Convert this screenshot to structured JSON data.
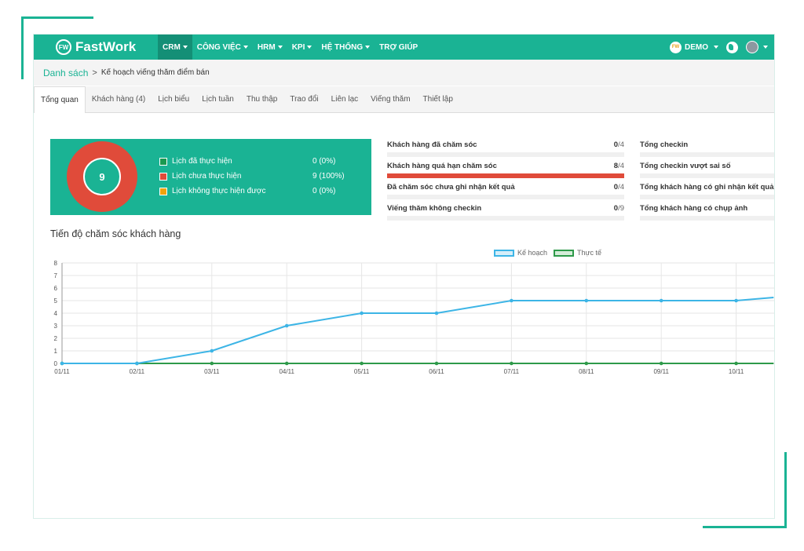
{
  "app": {
    "logo_badge": "FW",
    "logo_text": "FastWork",
    "brand_color": "#1ab394"
  },
  "nav": {
    "items": [
      {
        "label": "CRM",
        "active": true
      },
      {
        "label": "CÔNG VIỆC",
        "active": false
      },
      {
        "label": "HRM",
        "active": false
      },
      {
        "label": "KPI",
        "active": false
      },
      {
        "label": "HỆ THỐNG",
        "active": false
      },
      {
        "label": "TRỢ GIÚP",
        "active": false
      }
    ],
    "demo_badge": "FW",
    "demo_label": "DEMO"
  },
  "breadcrumb": {
    "link": "Danh sách",
    "separator": ">",
    "current": "Kế hoạch viếng thăm điểm bán"
  },
  "tabs": [
    {
      "label": "Tổng quan",
      "active": true
    },
    {
      "label": "Khách hàng (4)",
      "active": false
    },
    {
      "label": "Lịch biểu",
      "active": false
    },
    {
      "label": "Lịch tuần",
      "active": false
    },
    {
      "label": "Thu thập",
      "active": false
    },
    {
      "label": "Trao đổi",
      "active": false
    },
    {
      "label": "Liên lạc",
      "active": false
    },
    {
      "label": "Viếng thăm",
      "active": false
    },
    {
      "label": "Thiết lập",
      "active": false
    }
  ],
  "summary": {
    "total": "9",
    "legend": [
      {
        "label": "Lịch đã thực hiện",
        "value": "0  (0%)",
        "color": "#1a9950",
        "count": 0
      },
      {
        "label": "Lịch chưa thực hiện",
        "value": "9  (100%)",
        "color": "#e04b3a",
        "count": 9
      },
      {
        "label": "Lịch không thực hiện được",
        "value": "0  (0%)",
        "color": "#f0a30a",
        "count": 0
      }
    ]
  },
  "stats_left": [
    {
      "label": "Khách hàng đã chăm sóc",
      "value": "0",
      "total": "/4",
      "fill": 0
    },
    {
      "label": "Khách hàng quá hạn chăm sóc",
      "value": "8",
      "total": "/4",
      "fill": 1
    },
    {
      "label": "Đã chăm sóc chưa ghi nhận kết quả",
      "value": "0",
      "total": "/4",
      "fill": 0
    },
    {
      "label": "Viếng thăm không checkin",
      "value": "0",
      "total": "/9",
      "fill": 0
    }
  ],
  "stats_right": [
    {
      "label": "Tổng checkin"
    },
    {
      "label": "Tổng checkin vượt sai số"
    },
    {
      "label": "Tổng khách hàng có ghi nhận kết quả"
    },
    {
      "label": "Tổng khách hàng có chụp ảnh"
    }
  ],
  "chart_title": "Tiến độ chăm sóc khách hàng",
  "chart_data": {
    "type": "line",
    "x": [
      "01/11",
      "02/11",
      "03/11",
      "04/11",
      "05/11",
      "06/11",
      "07/11",
      "08/11",
      "09/11",
      "10/11"
    ],
    "series": [
      {
        "name": "Kế hoạch",
        "color": "#3db5e6",
        "values": [
          0,
          0,
          1,
          3,
          4,
          4,
          5,
          5,
          5,
          5
        ],
        "next_value": 5.5
      },
      {
        "name": "Thực tế",
        "color": "#2e9a4a",
        "values": [
          0,
          0,
          0,
          0,
          0,
          0,
          0,
          0,
          0,
          0
        ],
        "next_value": 0
      }
    ],
    "ylim": [
      0,
      8
    ],
    "yticks": [
      0,
      1,
      2,
      3,
      4,
      5,
      6,
      7,
      8
    ],
    "grid": true,
    "legend": "top"
  }
}
